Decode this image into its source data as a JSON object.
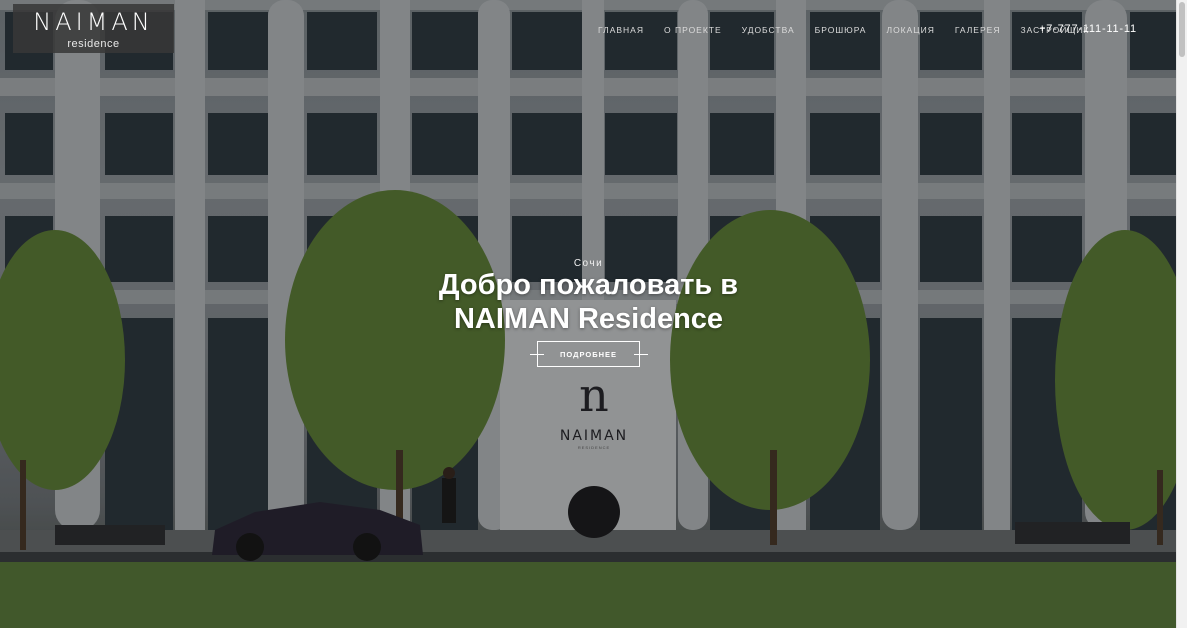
{
  "header": {
    "logo_name": "NAIMAN",
    "logo_sub": "residence",
    "nav": [
      "ГЛАВНАЯ",
      "О ПРОЕКТЕ",
      "УДОБСТВА",
      "БРОШЮРА",
      "ЛОКАЦИЯ",
      "ГАЛЕРЕЯ",
      "ЗАСТРОЙЩИК"
    ],
    "phone": "+7-777-111-11-11"
  },
  "hero": {
    "city": "Сочи",
    "headline_line1": "Добро пожаловать в",
    "headline_line2": "NAIMAN Residence",
    "button_label": "ПОДРОБНЕЕ"
  },
  "sign": {
    "mark": "n",
    "name": "NAIMAN",
    "sub": "RESIDENCE"
  },
  "colors": {
    "overlay": "#000000",
    "text": "#ffffff",
    "logo_box": "#373737",
    "grass": "#5b7a3c"
  }
}
